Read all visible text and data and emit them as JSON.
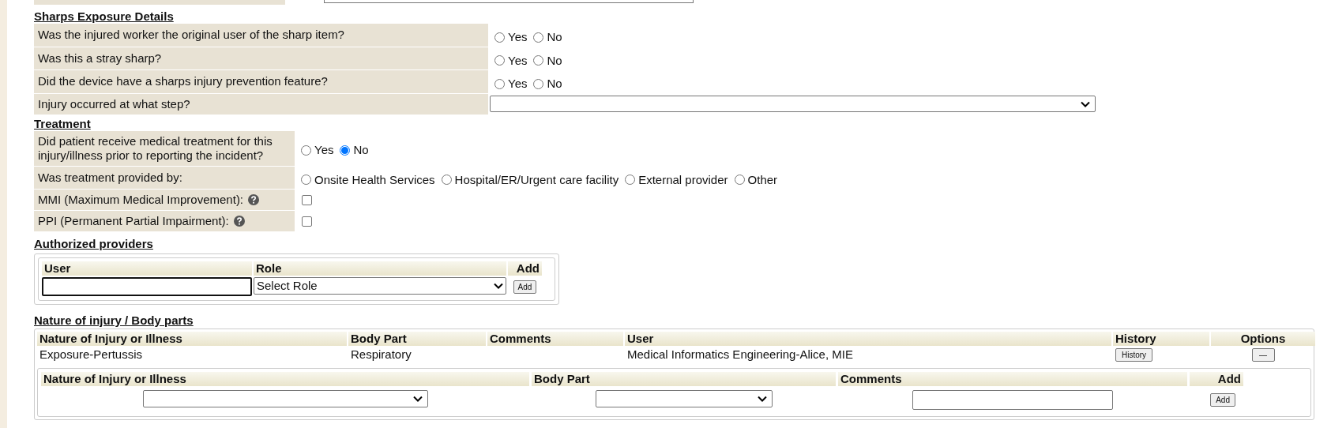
{
  "sharps": {
    "heading": "Sharps Exposure Details",
    "questions": [
      {
        "kind": "radio",
        "label": "Was the injured worker the original user of the sharp item?",
        "options": [
          {
            "label": "Yes",
            "selected": false
          },
          {
            "label": "No",
            "selected": false
          }
        ]
      },
      {
        "kind": "radio",
        "label": "Was this a stray sharp?",
        "options": [
          {
            "label": "Yes",
            "selected": false
          },
          {
            "label": "No",
            "selected": false
          }
        ]
      },
      {
        "kind": "radio",
        "label": "Did the device have a sharps injury prevention feature?",
        "options": [
          {
            "label": "Yes",
            "selected": false
          },
          {
            "label": "No",
            "selected": false
          }
        ]
      },
      {
        "kind": "select",
        "label": "Injury occurred at what step?"
      }
    ]
  },
  "treatment": {
    "heading": "Treatment",
    "questions": [
      {
        "kind": "radio",
        "label": "Did patient receive medical treatment for this injury/illness prior to reporting the incident?",
        "options": [
          {
            "label": "Yes",
            "selected": false
          },
          {
            "label": "No",
            "selected": true
          }
        ]
      },
      {
        "kind": "radio",
        "label": "Was treatment provided by:",
        "options": [
          {
            "label": "Onsite Health Services",
            "selected": false
          },
          {
            "label": "Hospital/ER/Urgent care facility",
            "selected": false
          },
          {
            "label": "External provider",
            "selected": false
          },
          {
            "label": "Other",
            "selected": false
          }
        ]
      },
      {
        "kind": "checkbox",
        "label": "MMI (Maximum Medical Improvement):",
        "help": true,
        "checked": false
      },
      {
        "kind": "checkbox",
        "label": "PPI (Permanent Partial Impairment):",
        "help": true,
        "checked": false
      }
    ]
  },
  "providers": {
    "heading": "Authorized providers",
    "columns": [
      "User",
      "Role",
      "Add"
    ],
    "role_select": "Select Role",
    "add_button": "Add"
  },
  "injuries": {
    "heading": "Nature of injury / Body parts",
    "columns": [
      "Nature of Injury or Illness",
      "Body Part",
      "Comments",
      "User",
      "History",
      "Options"
    ],
    "rows": [
      {
        "nature": "Exposure-Pertussis",
        "body_part": "Respiratory",
        "user": "Medical Informatics Engineering-Alice, MIE",
        "history_button": "History",
        "option_button": "—"
      }
    ],
    "add_form": {
      "columns": [
        "Nature of Injury or Illness",
        "Body Part",
        "Comments",
        "Add"
      ],
      "add_button": "Add"
    }
  }
}
